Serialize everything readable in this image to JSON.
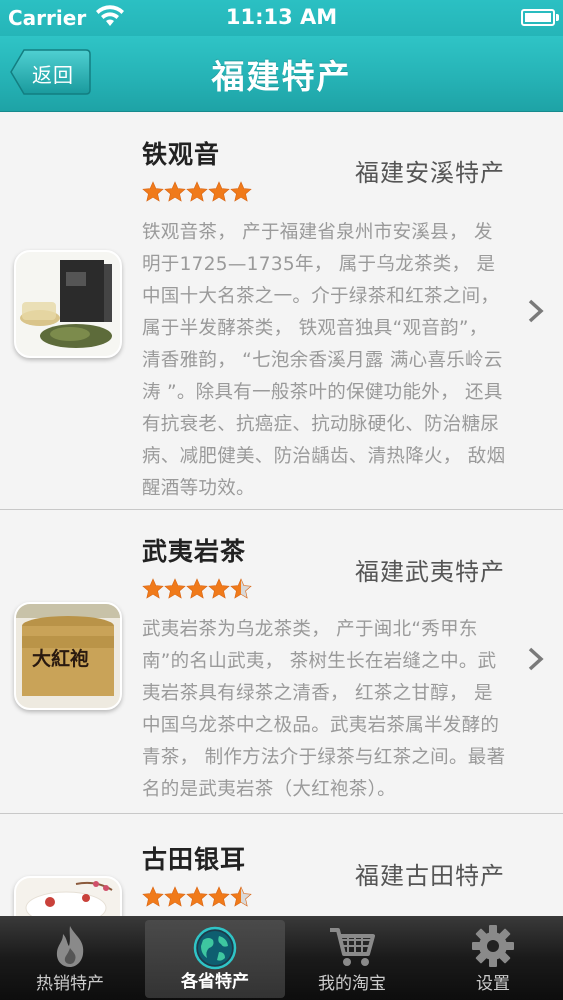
{
  "status_bar": {
    "carrier": "Carrier",
    "time": "11:13 AM"
  },
  "nav": {
    "back_label": "返回",
    "title": "福建特产"
  },
  "items": [
    {
      "name": "铁观音",
      "region": "福建安溪特产",
      "rating": 5,
      "description": "铁观音茶， 产于福建省泉州市安溪县， 发明于1725—1735年， 属于乌龙茶类， 是中国十大名茶之一。介于绿茶和红茶之间， 属于半发酵茶类， 铁观音独具“观音韵”， 清香雅韵， “七泡余香溪月露 满心喜乐岭云涛 ”。除具有一般茶叶的保健功能外， 还具有抗衰老、抗癌症、抗动脉硬化、防治糖尿病、减肥健美、防治龋齿、清热降火， 敌烟醒酒等功效。",
      "thumb_icon": "tea-box-icon"
    },
    {
      "name": "武夷岩茶",
      "region": "福建武夷特产",
      "rating": 4.5,
      "description": "武夷岩茶为乌龙茶类， 产于闽北“秀甲东南”的名山武夷， 茶树生长在岩缝之中。武夷岩茶具有绿茶之清香， 红茶之甘醇， 是中国乌龙茶中之极品。武夷岩茶属半发酵的青茶， 制作方法介于绿茶与红茶之间。最著名的是武夷岩茶（大红袍茶）。",
      "thumb_icon": "tea-tin-icon",
      "thumb_text": "大紅袍"
    },
    {
      "name": "古田银耳",
      "region": "福建古田特产",
      "rating": 4.5,
      "thumb_icon": "tremella-icon"
    }
  ],
  "tabs": [
    {
      "label": "热销特产",
      "icon": "flame-icon"
    },
    {
      "label": "各省特产",
      "icon": "globe-icon"
    },
    {
      "label": "我的淘宝",
      "icon": "cart-icon"
    },
    {
      "label": "设置",
      "icon": "gear-icon"
    }
  ]
}
